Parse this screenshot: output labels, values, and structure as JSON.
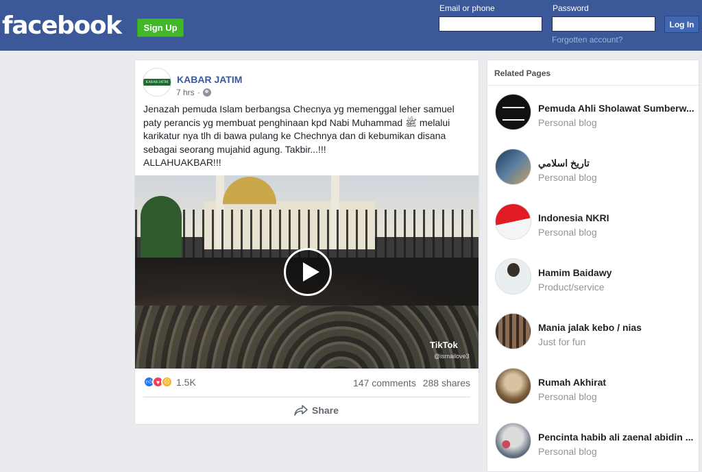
{
  "header": {
    "logo": "facebook",
    "signup_label": "Sign Up",
    "email_label": "Email or phone",
    "password_label": "Password",
    "login_label": "Log In",
    "forgot_label": "Forgotten account?"
  },
  "post": {
    "page_name": "KABAR JATIM",
    "page_avatar_text": "KABAR JATIM",
    "time": "7 hrs",
    "separator": "·",
    "text": "Jenazah pemuda Islam berbangsa Checnya yg memenggal leher samuel paty perancis yg membuat penghinaan kpd Nabi Muhammad ﷺ melalui karikatur nya tlh di bawa pulang ke Chechnya dan di kebumikan disana sebagai seorang mujahid agung. Takbir...!!!\nALLAHUAKBAR!!!",
    "video": {
      "watermark": "TikTok",
      "handle": "@ismailove3"
    },
    "reaction_count": "1.5K",
    "comments": "147 comments",
    "shares": "288 shares",
    "share_label": "Share"
  },
  "related": {
    "title": "Related Pages",
    "items": [
      {
        "name": "Pemuda Ahli Sholawat Sumberw...",
        "category": "Personal blog"
      },
      {
        "name": "تاريخ اسلامي",
        "category": "Personal blog"
      },
      {
        "name": "Indonesia NKRI",
        "category": "Personal blog"
      },
      {
        "name": "Hamim Baidawy",
        "category": "Product/service"
      },
      {
        "name": "Mania jalak kebo / nias",
        "category": "Just for fun"
      },
      {
        "name": "Rumah Akhirat",
        "category": "Personal blog"
      },
      {
        "name": "Pencinta habib ali zaenal abidin ...",
        "category": "Personal blog"
      }
    ]
  },
  "colors": {
    "brand": "#3b5998",
    "signup": "#42b72a",
    "link": "#385898"
  }
}
